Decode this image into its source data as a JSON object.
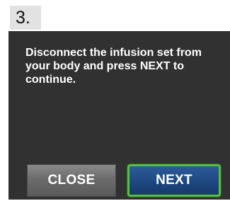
{
  "step": {
    "number": "3."
  },
  "screen": {
    "message": "Disconnect the infusion set from your body and press NEXT to continue.",
    "buttons": {
      "close_label": "CLOSE",
      "next_label": "NEXT"
    }
  },
  "colors": {
    "screen_background": "#313131",
    "close_button": "#6c6c6c",
    "next_button": "#1f4a84",
    "next_button_border": "#56c13f",
    "step_badge": "#e2e2e2"
  }
}
